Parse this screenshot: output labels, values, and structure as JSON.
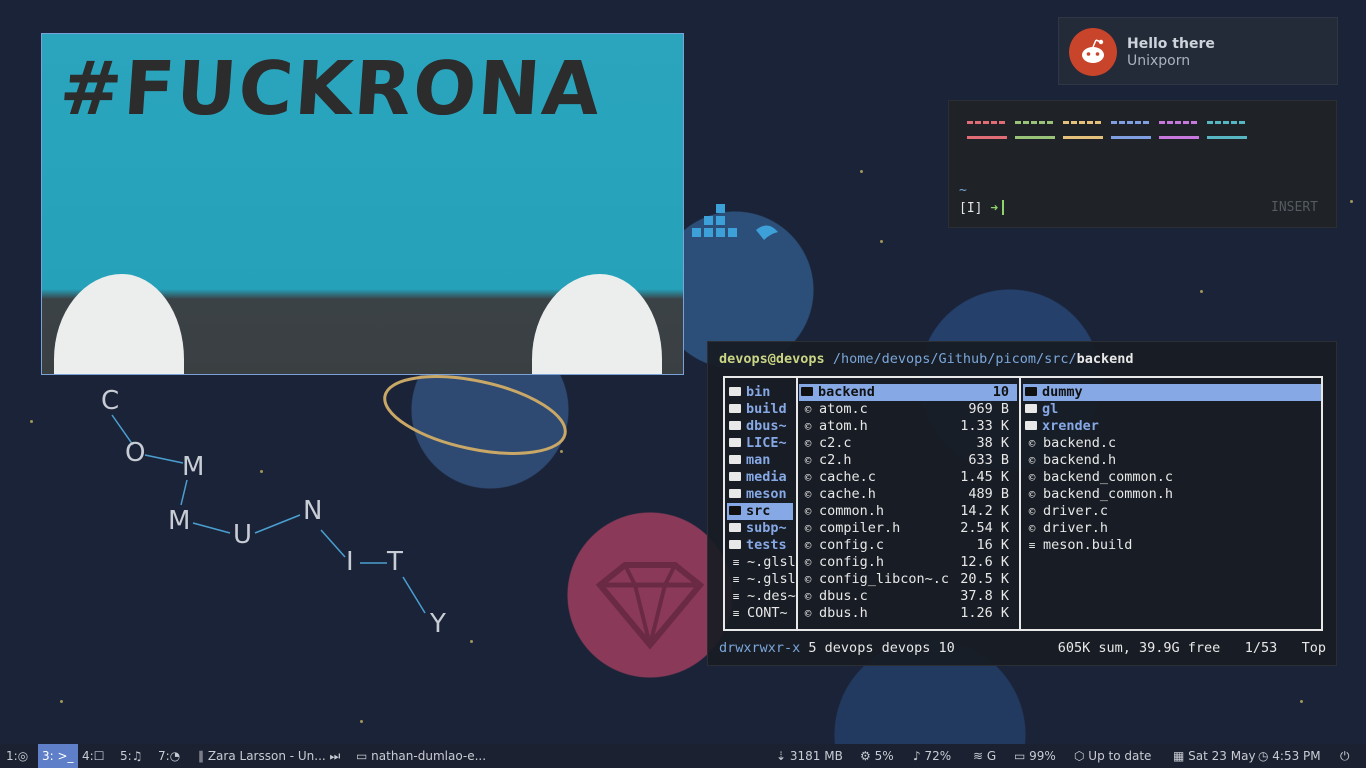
{
  "notification": {
    "title": "Hello there",
    "body": "Unixporn",
    "icon": "reddit-icon"
  },
  "terminal": {
    "colors_top": [
      "#e06c75",
      "#98c379",
      "#e5c07b",
      "#7f9fe0",
      "#c678dd",
      "#56b6c2"
    ],
    "tilde": "~",
    "prompt_label": "[I]",
    "prompt_arrow": "➜",
    "mode": "INSERT"
  },
  "ranger": {
    "header": {
      "user": "devops@devops",
      "path": "/home/devops/Github/picom/src/",
      "current": "backend"
    },
    "parent": [
      {
        "name": "bin",
        "type": "dir"
      },
      {
        "name": "build",
        "type": "dir"
      },
      {
        "name": "dbus~",
        "type": "dir"
      },
      {
        "name": "LICE~",
        "type": "dir"
      },
      {
        "name": "man",
        "type": "dir"
      },
      {
        "name": "media",
        "type": "dir"
      },
      {
        "name": "meson",
        "type": "dir"
      },
      {
        "name": "src",
        "type": "dir",
        "selected": true
      },
      {
        "name": "subp~",
        "type": "dir"
      },
      {
        "name": "tests",
        "type": "dir"
      },
      {
        "name": "~.glsl",
        "type": "txt"
      },
      {
        "name": "~.glsl",
        "type": "txt"
      },
      {
        "name": "~.des~",
        "type": "txt"
      },
      {
        "name": "CONT~",
        "type": "txt"
      }
    ],
    "current": [
      {
        "name": "backend",
        "size": "10",
        "type": "dir",
        "selected": true
      },
      {
        "name": "atom.c",
        "size": "969 B",
        "type": "c"
      },
      {
        "name": "atom.h",
        "size": "1.33 K",
        "type": "c"
      },
      {
        "name": "c2.c",
        "size": "38 K",
        "type": "c"
      },
      {
        "name": "c2.h",
        "size": "633 B",
        "type": "c"
      },
      {
        "name": "cache.c",
        "size": "1.45 K",
        "type": "c"
      },
      {
        "name": "cache.h",
        "size": "489 B",
        "type": "c"
      },
      {
        "name": "common.h",
        "size": "14.2 K",
        "type": "c"
      },
      {
        "name": "compiler.h",
        "size": "2.54 K",
        "type": "c"
      },
      {
        "name": "config.c",
        "size": "16 K",
        "type": "c"
      },
      {
        "name": "config.h",
        "size": "12.6 K",
        "type": "c"
      },
      {
        "name": "config_libcon~.c",
        "size": "20.5 K",
        "type": "c"
      },
      {
        "name": "dbus.c",
        "size": "37.8 K",
        "type": "c"
      },
      {
        "name": "dbus.h",
        "size": "1.26 K",
        "type": "c"
      }
    ],
    "preview": [
      {
        "name": "dummy",
        "type": "dir",
        "selected": true
      },
      {
        "name": "gl",
        "type": "dir"
      },
      {
        "name": "xrender",
        "type": "dir"
      },
      {
        "name": "backend.c",
        "type": "c"
      },
      {
        "name": "backend.h",
        "type": "c"
      },
      {
        "name": "backend_common.c",
        "type": "c"
      },
      {
        "name": "backend_common.h",
        "type": "c"
      },
      {
        "name": "driver.c",
        "type": "c"
      },
      {
        "name": "driver.h",
        "type": "c"
      },
      {
        "name": "meson.build",
        "type": "txt"
      }
    ],
    "footer": {
      "perms": "drwxrwxr-x",
      "info": "5 devops devops 10",
      "summary": "605K sum, 39.9G free",
      "position": "1/53",
      "scroll": "Top"
    }
  },
  "wallpaper": {
    "graffiti": "#FUCKRONA",
    "community_letters": [
      "C",
      "O",
      "M",
      "M",
      "U",
      "N",
      "I",
      "T",
      "Y"
    ]
  },
  "taskbar": {
    "workspaces": [
      {
        "label": "1:",
        "icon": "chrome-icon",
        "active": false
      },
      {
        "label": "3:",
        "icon": "terminal-icon",
        "active": true
      },
      {
        "label": "4:",
        "icon": "chat-icon",
        "active": false
      },
      {
        "label": "5:",
        "icon": "music-icon",
        "active": false
      },
      {
        "label": "7:",
        "icon": "github-icon",
        "active": false
      }
    ],
    "media": "Zara Larsson - Un...",
    "window": "nathan-dumlao-e...",
    "memory": "3181 MB",
    "cpu": "5%",
    "volume": "72%",
    "wifi": "G",
    "battery": "99%",
    "updates": "Up to date",
    "date": "Sat 23 May",
    "time": "4:53 PM"
  }
}
